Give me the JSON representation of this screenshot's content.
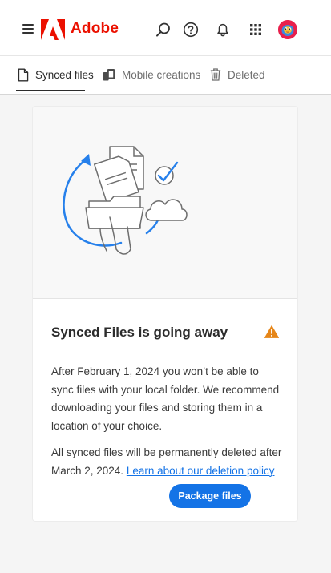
{
  "header": {
    "brand": "Adobe",
    "brand_color": "#eb1000",
    "icons": [
      "menu-icon",
      "search-icon",
      "help-icon",
      "bell-icon",
      "apps-grid-icon",
      "avatar"
    ]
  },
  "tabs": [
    {
      "label": "Synced files",
      "icon": "file-icon",
      "active": true
    },
    {
      "label": "Mobile creations",
      "icon": "mobile-creations-icon",
      "active": false
    },
    {
      "label": "Deleted",
      "icon": "trash-icon",
      "active": false
    }
  ],
  "notice": {
    "title": "Synced Files is going away",
    "paragraph1": "After February 1, 2024 you won’t be able to sync files with your local folder. We recommend downloading your files and storing them in a location of your choice.",
    "paragraph2_prefix": "All synced files will be permanently deleted after March 2, 2024.",
    "link_label": "Learn about our deletion policy",
    "button_label": "Package files",
    "warning_color": "#e68619",
    "accent_color": "#1473e6"
  }
}
